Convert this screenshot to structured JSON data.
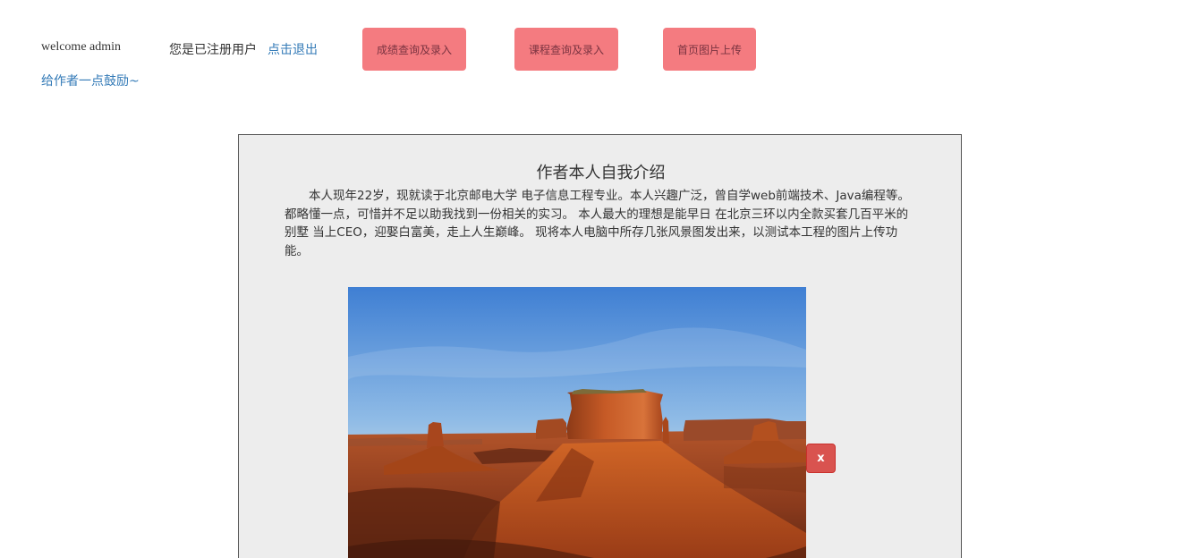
{
  "header": {
    "welcome_text": "welcome admin",
    "registered_text": "您是已注册用户",
    "logout_link": "点击退出",
    "encourage_link": "给作者一点鼓励~"
  },
  "nav": {
    "grades_button": "成绩查询及录入",
    "courses_button": "课程查询及录入",
    "upload_button": "首页图片上传"
  },
  "panel": {
    "title": "作者本人自我介绍",
    "intro": "本人现年22岁，现就读于北京邮电大学 电子信息工程专业。本人兴趣广泛，曾自学web前端技术、Java编程等。 都略懂一点，可惜并不足以助我找到一份相关的实习。 本人最大的理想是能早日 在北京三环以内全款买套几百平米的别墅 当上CEO，迎娶白富美，走上人生巅峰。 现将本人电脑中所存几张风景图发出来，以测试本工程的图片上传功能。",
    "close_button": "x"
  },
  "colors": {
    "nav_button_bg": "#f47b80",
    "link": "#337ab7",
    "close_button_bg": "#d9534f",
    "panel_bg": "#ededed"
  }
}
